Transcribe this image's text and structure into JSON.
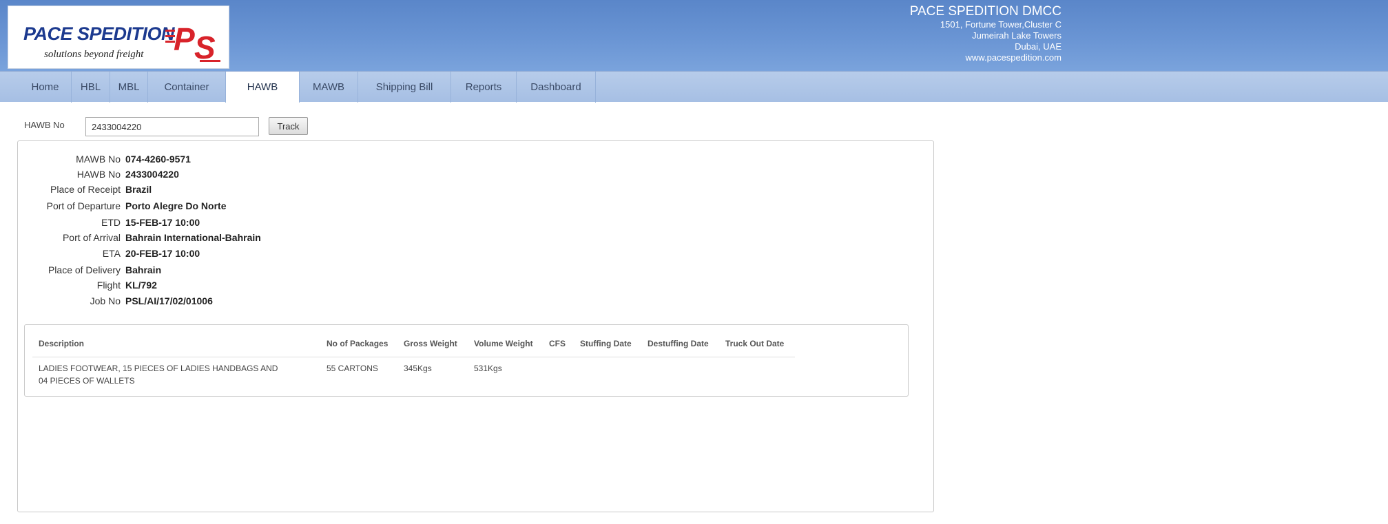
{
  "header": {
    "logo": {
      "brand": "PACE SPEDITION",
      "tagline": "solutions beyond freight",
      "monogram": "PS"
    },
    "company": {
      "name": "PACE SPEDITION DMCC",
      "address_lines": [
        "1501, Fortune Tower,Cluster C",
        "Jumeirah Lake Towers",
        "Dubai, UAE",
        "www.pacespedition.com"
      ]
    }
  },
  "nav": {
    "tabs": [
      {
        "label": "Home"
      },
      {
        "label": "HBL"
      },
      {
        "label": "MBL"
      },
      {
        "label": "Container"
      },
      {
        "label": "HAWB",
        "active": true
      },
      {
        "label": "MAWB"
      },
      {
        "label": "Shipping Bill"
      },
      {
        "label": "Reports"
      },
      {
        "label": "Dashboard"
      }
    ]
  },
  "search": {
    "label": "HAWB No",
    "value": "2433004220",
    "button_label": "Track"
  },
  "details": [
    {
      "label": "MAWB No",
      "value": "074-4260-9571"
    },
    {
      "label": "HAWB No",
      "value": "2433004220"
    },
    {
      "label": "Place of Receipt",
      "value": "Brazil"
    },
    {
      "label": "Port of Departure",
      "value": "Porto Alegre Do Norte"
    },
    {
      "label": "ETD",
      "value": "15-FEB-17 10:00"
    },
    {
      "label": "Port of Arrival",
      "value": "Bahrain International-Bahrain"
    },
    {
      "label": "ETA",
      "value": "20-FEB-17 10:00"
    },
    {
      "label": "Place of Delivery",
      "value": "Bahrain"
    },
    {
      "label": "Flight",
      "value": "KL/792"
    },
    {
      "label": "Job No",
      "value": "PSL/AI/17/02/01006"
    }
  ],
  "cargo_table": {
    "columns": [
      "Description",
      "No of Packages",
      "Gross Weight",
      "Volume Weight",
      "CFS",
      "Stuffing Date",
      "Destuffing Date",
      "Truck Out Date"
    ],
    "rows": [
      {
        "description_lines": [
          "LADIES FOOTWEAR, 15 PIECES OF LADIES HANDBAGS AND",
          "04 PIECES OF WALLETS"
        ],
        "packages": "55 CARTONS",
        "gross_weight": "345Kgs",
        "volume_weight": "531Kgs",
        "cfs": "",
        "stuffing_date": "",
        "destuffing_date": "",
        "truck_out_date": ""
      }
    ]
  },
  "colors": {
    "header_bg": "#6a95d4",
    "nav_bg": "#a6bfe4",
    "logo_blue": "#1c3a8f",
    "logo_red": "#d8232a"
  }
}
